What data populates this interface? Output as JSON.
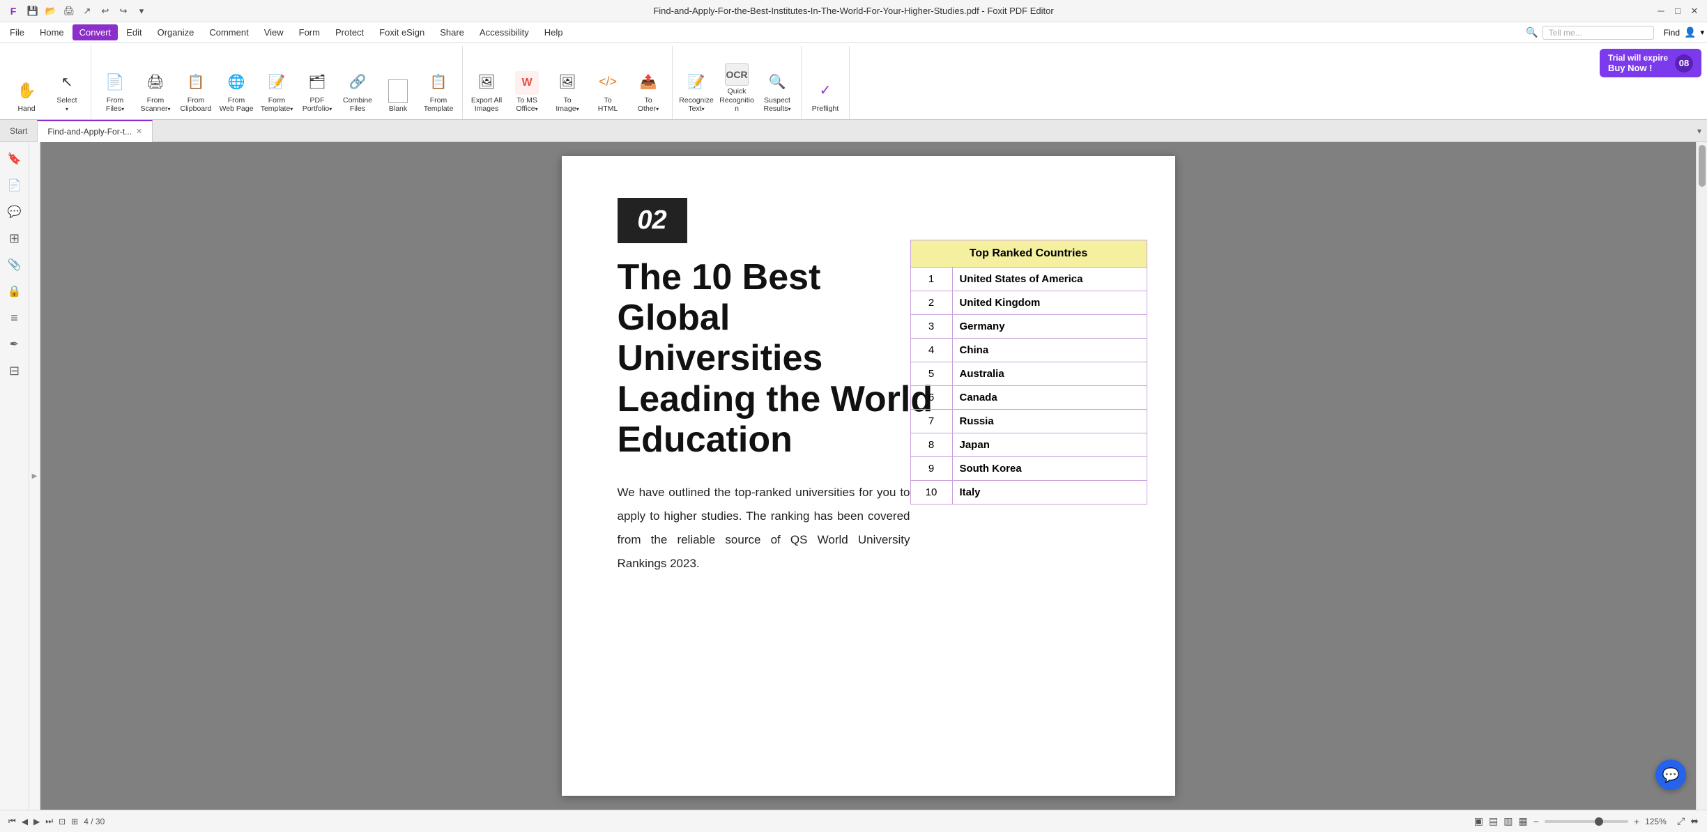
{
  "app": {
    "title": "Find-and-Apply-For-the-Best-Institutes-In-The-World-For-Your-Higher-Studies.pdf - Foxit PDF Editor",
    "window_controls": [
      "minimize",
      "maximize",
      "close"
    ]
  },
  "quick_access": {
    "icons": [
      "save",
      "open",
      "print",
      "share",
      "undo",
      "redo",
      "customize"
    ]
  },
  "menu": {
    "items": [
      "File",
      "Home",
      "Convert",
      "Edit",
      "Organize",
      "Comment",
      "View",
      "Form",
      "Protect",
      "Foxit eSign",
      "Share",
      "Accessibility",
      "Help"
    ],
    "active": "Convert"
  },
  "ribbon": {
    "groups": [
      {
        "name": "select-group",
        "buttons": [
          {
            "id": "hand-btn",
            "label": "Hand",
            "icon": "✋",
            "has_arrow": false
          },
          {
            "id": "select-btn",
            "label": "Select",
            "icon": "↖",
            "has_arrow": true
          }
        ]
      },
      {
        "name": "from-group",
        "buttons": [
          {
            "id": "from-files-btn",
            "label": "From Files",
            "icon": "📄",
            "has_arrow": true
          },
          {
            "id": "from-scanner-btn",
            "label": "From Scanner",
            "icon": "🖨",
            "has_arrow": true
          },
          {
            "id": "from-clipboard-btn",
            "label": "From Clipboard",
            "icon": "📋",
            "has_arrow": false
          },
          {
            "id": "from-webpage-btn",
            "label": "From Web Page",
            "icon": "🌐",
            "has_arrow": false
          },
          {
            "id": "form-btn",
            "label": "Form Template",
            "icon": "📝",
            "has_arrow": true
          },
          {
            "id": "pdf-portfolio-btn",
            "label": "PDF Portfolio",
            "icon": "🗂",
            "has_arrow": true
          },
          {
            "id": "combine-files-btn",
            "label": "Combine Files",
            "icon": "🔗",
            "has_arrow": false
          },
          {
            "id": "blank-btn",
            "label": "Blank",
            "icon": "⬜",
            "has_arrow": false
          },
          {
            "id": "from-template-btn",
            "label": "From Template",
            "icon": "📋",
            "has_arrow": false
          }
        ]
      },
      {
        "name": "export-group",
        "buttons": [
          {
            "id": "export-all-images-btn",
            "label": "Export All Images",
            "icon": "🖼",
            "has_arrow": false
          },
          {
            "id": "to-ms-office-btn",
            "label": "To MS Office",
            "icon": "W",
            "has_arrow": true
          },
          {
            "id": "to-image-btn",
            "label": "To Image",
            "icon": "🖼",
            "has_arrow": true
          },
          {
            "id": "to-html-btn",
            "label": "To HTML",
            "icon": "🌐",
            "has_arrow": false
          },
          {
            "id": "to-other-btn",
            "label": "To Other",
            "icon": "📤",
            "has_arrow": true
          }
        ]
      },
      {
        "name": "ocr-group",
        "buttons": [
          {
            "id": "recognize-text-btn",
            "label": "Recognize Text",
            "icon": "T",
            "has_arrow": true
          },
          {
            "id": "quick-recognition-btn",
            "label": "Quick Recognition",
            "icon": "⚡",
            "has_arrow": false
          },
          {
            "id": "suspect-results-btn",
            "label": "Suspect Results",
            "icon": "🔍",
            "has_arrow": true
          }
        ]
      },
      {
        "name": "preflight-group",
        "buttons": [
          {
            "id": "preflight-btn",
            "label": "Preflight",
            "icon": "✓",
            "has_arrow": false
          }
        ]
      }
    ],
    "trial_badge": {
      "line1": "Trial will expire",
      "line2": "Buy Now !",
      "number": "08"
    },
    "search": {
      "placeholder": "Tell me..."
    },
    "find_label": "Find"
  },
  "tabs": {
    "items": [
      {
        "id": "start-tab",
        "label": "Start",
        "active": false,
        "closable": false
      },
      {
        "id": "doc-tab",
        "label": "Find-and-Apply-For-t...",
        "active": true,
        "closable": true
      }
    ]
  },
  "sidebar": {
    "icons": [
      {
        "id": "bookmark-icon",
        "glyph": "🔖"
      },
      {
        "id": "pages-icon",
        "glyph": "📄"
      },
      {
        "id": "comments-icon",
        "glyph": "💬"
      },
      {
        "id": "layers-icon",
        "glyph": "⊞"
      },
      {
        "id": "attachments-icon",
        "glyph": "📎"
      },
      {
        "id": "security-icon",
        "glyph": "🔒"
      },
      {
        "id": "fields-icon",
        "glyph": "≡"
      },
      {
        "id": "signatures-icon",
        "glyph": "✒"
      },
      {
        "id": "compare-icon",
        "glyph": "⊟"
      }
    ]
  },
  "document": {
    "page_number_display": "02",
    "title_line1": "The 10 Best",
    "title_line2": "Global Universities",
    "title_line3": "Leading the World",
    "title_line4": "Education",
    "body_text": "We have outlined the top-ranked universities for you to apply to higher studies. The ranking has been covered from the reliable source of QS World University Rankings 2023.",
    "table": {
      "header": "Top Ranked Countries",
      "rows": [
        {
          "rank": "1",
          "country": "United States of America"
        },
        {
          "rank": "2",
          "country": "United Kingdom"
        },
        {
          "rank": "3",
          "country": "Germany"
        },
        {
          "rank": "4",
          "country": "China"
        },
        {
          "rank": "5",
          "country": "Australia"
        },
        {
          "rank": "6",
          "country": "Canada"
        },
        {
          "rank": "7",
          "country": "Russia"
        },
        {
          "rank": "8",
          "country": "Japan"
        },
        {
          "rank": "9",
          "country": "South Korea"
        },
        {
          "rank": "10",
          "country": "Italy"
        }
      ]
    }
  },
  "status_bar": {
    "page_nav": "4 / 30",
    "view_icons": [
      "single",
      "double",
      "two-page",
      "continuous"
    ],
    "zoom_minus": "−",
    "zoom_plus": "+",
    "zoom_level": "125%",
    "fit_page": "⤢",
    "fit_width": "⬌"
  }
}
